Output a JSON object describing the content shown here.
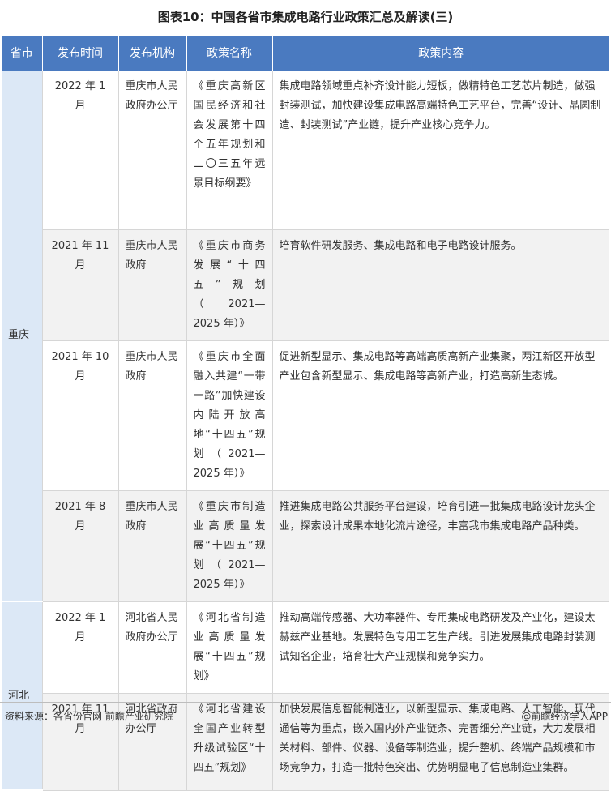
{
  "title": "图表10：中国各省市集成电路行业政策汇总及解读(三)",
  "headers": [
    "省市",
    "发布时间",
    "发布机构",
    "政策名称",
    "政策内容"
  ],
  "provinces": [
    {
      "name": "重庆",
      "rows": [
        {
          "time": "2022 年 1 月",
          "agency": "重庆市人民政府办公厅",
          "policy": "《重庆高新区国民经济和社会发展第十四个五年规划和二〇三五年远景目标纲要》",
          "content": "集成电路领域重点补齐设计能力短板，做精特色工艺芯片制造，做强封装测试，加快建设集成电路高端特色工艺平台，完善“设计、晶圆制造、封装测试”产业链，提升产业核心竞争力。"
        },
        {
          "time": "2021 年 11 月",
          "agency": "重庆市人民政府",
          "policy": "《重庆市商务发展“十四五”规划（2021—2025 年）》",
          "content": "培育软件研发服务、集成电路和电子电路设计服务。"
        },
        {
          "time": "2021 年 10 月",
          "agency": "重庆市人民政府",
          "policy": "《重庆市全面融入共建“一带一路”加快建设内陆开放高地“十四五”规划（2021—2025 年）》",
          "content": "促进新型显示、集成电路等高端高质高新产业集聚，两江新区开放型产业包含新型显示、集成电路等高新产业，打造高新生态城。"
        },
        {
          "time": "2021 年 8 月",
          "agency": "重庆市人民政府",
          "policy": "《重庆市制造业高质量发展“十四五”规划（2021—2025 年）》",
          "content": "推进集成电路公共服务平台建设，培育引进一批集成电路设计龙头企业，探索设计成果本地化流片途径，丰富我市集成电路产品种类。"
        }
      ]
    },
    {
      "name": "河北",
      "rows": [
        {
          "time": "2022 年 1 月",
          "agency": "河北省人民政府办公厅",
          "policy": "《河北省制造业高质量发展“十四五”规划》",
          "content": "推动高端传感器、大功率器件、专用集成电路研发及产业化，建设太赫兹产业基地。发展特色专用工艺生产线。引进发展集成电路封装测试知名企业，培育壮大产业规模和竞争实力。"
        },
        {
          "time": "2021 年 11 月",
          "agency": "河北省政府办公厅",
          "policy": "《河北省建设全国产业转型升级试验区“十四五”规划》",
          "content": "加快发展信息智能制造业，以新型显示、集成电路、人工智能、现代通信等为重点，嵌入国内外产业链条、完善细分产业链，大力发展相关材料、部件、仪器、设备等制造业，提升整机、终端产品规模和市场竞争力，打造一批特色突出、优势明显电子信息制造业集群。"
        }
      ]
    }
  ],
  "footer": {
    "source": "资料来源：各省份官网 前瞻产业研究院",
    "brand": "@前瞻经济学人APP"
  }
}
